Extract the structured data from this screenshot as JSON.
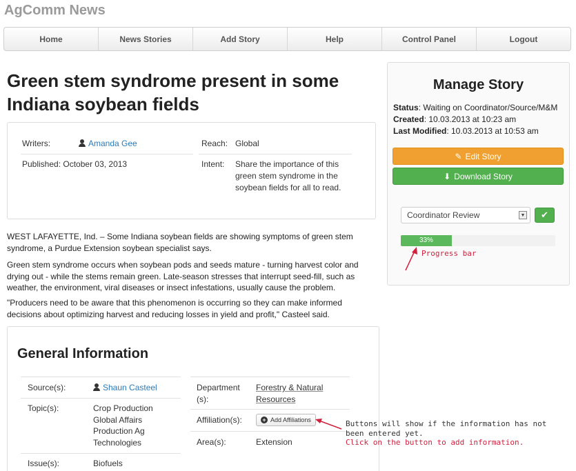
{
  "app": {
    "brand": "AgComm News"
  },
  "nav": [
    "Home",
    "News Stories",
    "Add Story",
    "Help",
    "Control Panel",
    "Logout"
  ],
  "story": {
    "title": "Green stem syndrome present in some Indiana soybean fields",
    "writers_label": "Writers:",
    "writer": "Amanda Gee",
    "published": "Published: October 03, 2013",
    "reach_label": "Reach:",
    "reach": "Global",
    "intent_label": "Intent:",
    "intent": "Share the importance of this green stem syndrome in the soybean fields for all to read.",
    "paragraphs": [
      "WEST LAFAYETTE, Ind. – Some Indiana soybean fields are showing symptoms of green stem syndrome, a Purdue Extension soybean specialist says.",
      "Green stem syndrome occurs when soybean pods and seeds mature - turning harvest color and drying out - while the stems remain green. Late-season stresses that interrupt seed-fill, such as weather, the environment, viral diseases or insect infestations, usually cause the problem.",
      "\"Producers need to be aware that this phenomenon is occurring so they can make informed decisions about optimizing harvest and reducing losses in yield and profit,\" Casteel said."
    ]
  },
  "general": {
    "title": "General Information",
    "source_label": "Source(s):",
    "source": "Shaun Casteel",
    "topic_label": "Topic(s):",
    "topics": [
      "Crop Production",
      "Global Affairs",
      "Production Ag",
      "Technologies"
    ],
    "issue_label": "Issue(s):",
    "issue": "Biofuels",
    "department_label": "Department (s):",
    "department": "Forestry & Natural Resources",
    "affiliation_label": "Affiliation(s):",
    "add_affiliations": "Add Affiliations",
    "area_label": "Area(s):",
    "area": "Extension"
  },
  "annotations": {
    "buttons_note": "Buttons will show if the information has not been entered yet.",
    "buttons_note_red": "Click on the button to add information.",
    "progress_note": "Progress bar"
  },
  "manage": {
    "title": "Manage Story",
    "status_label": "Status",
    "status": ": Waiting on Coordinator/Source/M&M",
    "created_label": "Created",
    "created": ": 10.03.2013 at 10:23 am",
    "modified_label": "Last Modified",
    "modified": ": 10.03.2013 at 10:53 am",
    "edit_label": "Edit Story",
    "download_label": "Download Story",
    "review_select": "Coordinator Review",
    "progress_label": "33%",
    "progress_value": 0.33
  },
  "colors": {
    "accent_orange": "#f0a030",
    "accent_green": "#52b04f",
    "link": "#2a7ab8",
    "annotation_red": "#d21f3c"
  }
}
